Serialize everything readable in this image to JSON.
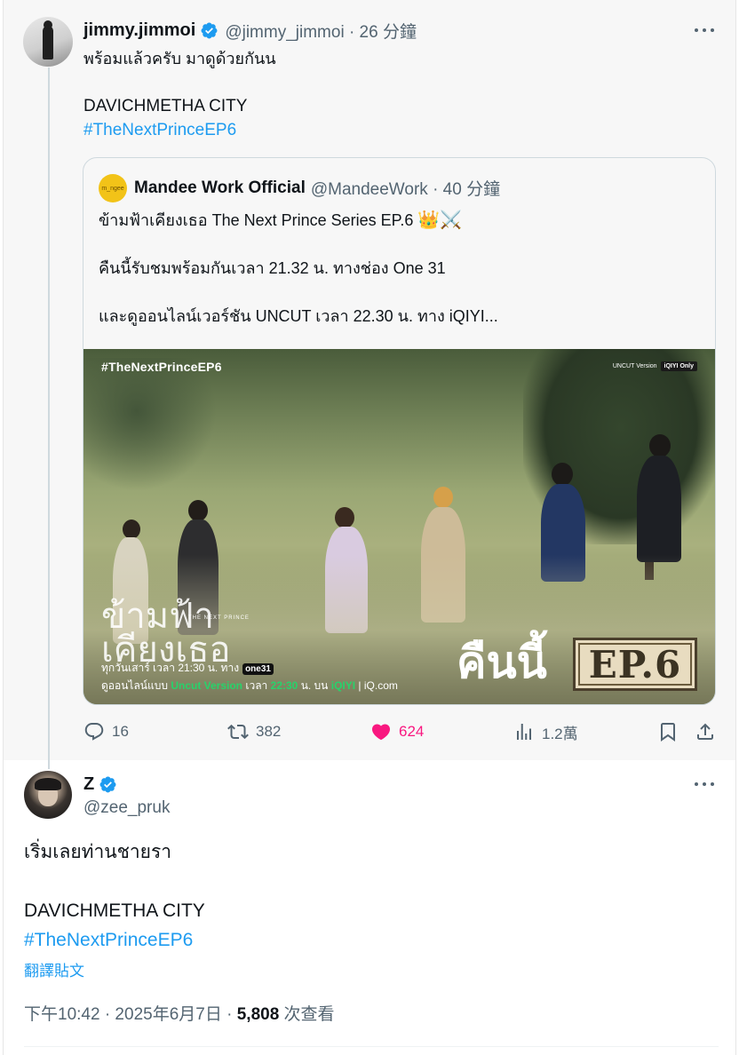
{
  "quoted_tweet": {
    "author": {
      "display_name": "jimmy.jimmoi",
      "handle_time": "@jimmy_jimmoi · 26 分鐘",
      "verified": true
    },
    "text_line1": "พร้อมแล้วครับ มาดูด้วยกันน",
    "text_line2": "DAVICHMETHA CITY",
    "hashtag": "#TheNextPrinceEP6",
    "quote": {
      "avatar_text": "m_ngee",
      "display_name": "Mandee Work Official",
      "handle_time": "@MandeeWork · 40 分鐘",
      "line1": "ข้ามฟ้าเคียงเธอ The Next Prince Series EP.6",
      "line1_emoji": "👑⚔️",
      "line2": "คืนนี้รับชมพร้อมกันเวลา 21.32 น. ทางช่อง One 31",
      "line3": "และดูออนไลน์เวอร์ชัน UNCUT เวลา 22.30 น. ทาง iQIYI...",
      "poster": {
        "tag": "#TheNextPrinceEP6",
        "uncut_version": "UNCUT Version",
        "iqiyi_only": "iQIYI Only",
        "logo_title": "ข้ามฟ้า\nเคียงเธอ",
        "logo_sub": "THE NEXT PRINCE",
        "sched1_prefix": "ทุกวันเสาร์ เวลา 21:30 น. ทาง",
        "sched1_channel": "one31",
        "sched2_prefix": "ดูออนไลน์แบบ",
        "sched2_version": "Uncut Version",
        "sched2_time_prefix": "เวลา",
        "sched2_time": "22:30",
        "sched2_on": "น. บน",
        "sched2_platform": "iQIYI",
        "sched2_site": "| iQ.com",
        "tonight": "คืนนี้",
        "episode": "EP.6"
      }
    },
    "actions": {
      "replies": "16",
      "retweets": "382",
      "likes": "624",
      "views": "1.2萬"
    },
    "colors": {
      "like_active": "#f91880",
      "link": "#1d9bf0",
      "muted": "#536471"
    }
  },
  "main_tweet": {
    "author": {
      "display_name": "Z",
      "handle": "@zee_pruk",
      "verified": true
    },
    "text_line1": "เริ่มเลยท่านชายรา",
    "text_line2": "DAVICHMETHA CITY",
    "hashtag": "#TheNextPrinceEP6",
    "translate_label": "翻譯貼文",
    "time": "下午10:42 · 2025年6月7日 · ",
    "views_count": "5,808",
    "views_label": " 次查看"
  }
}
